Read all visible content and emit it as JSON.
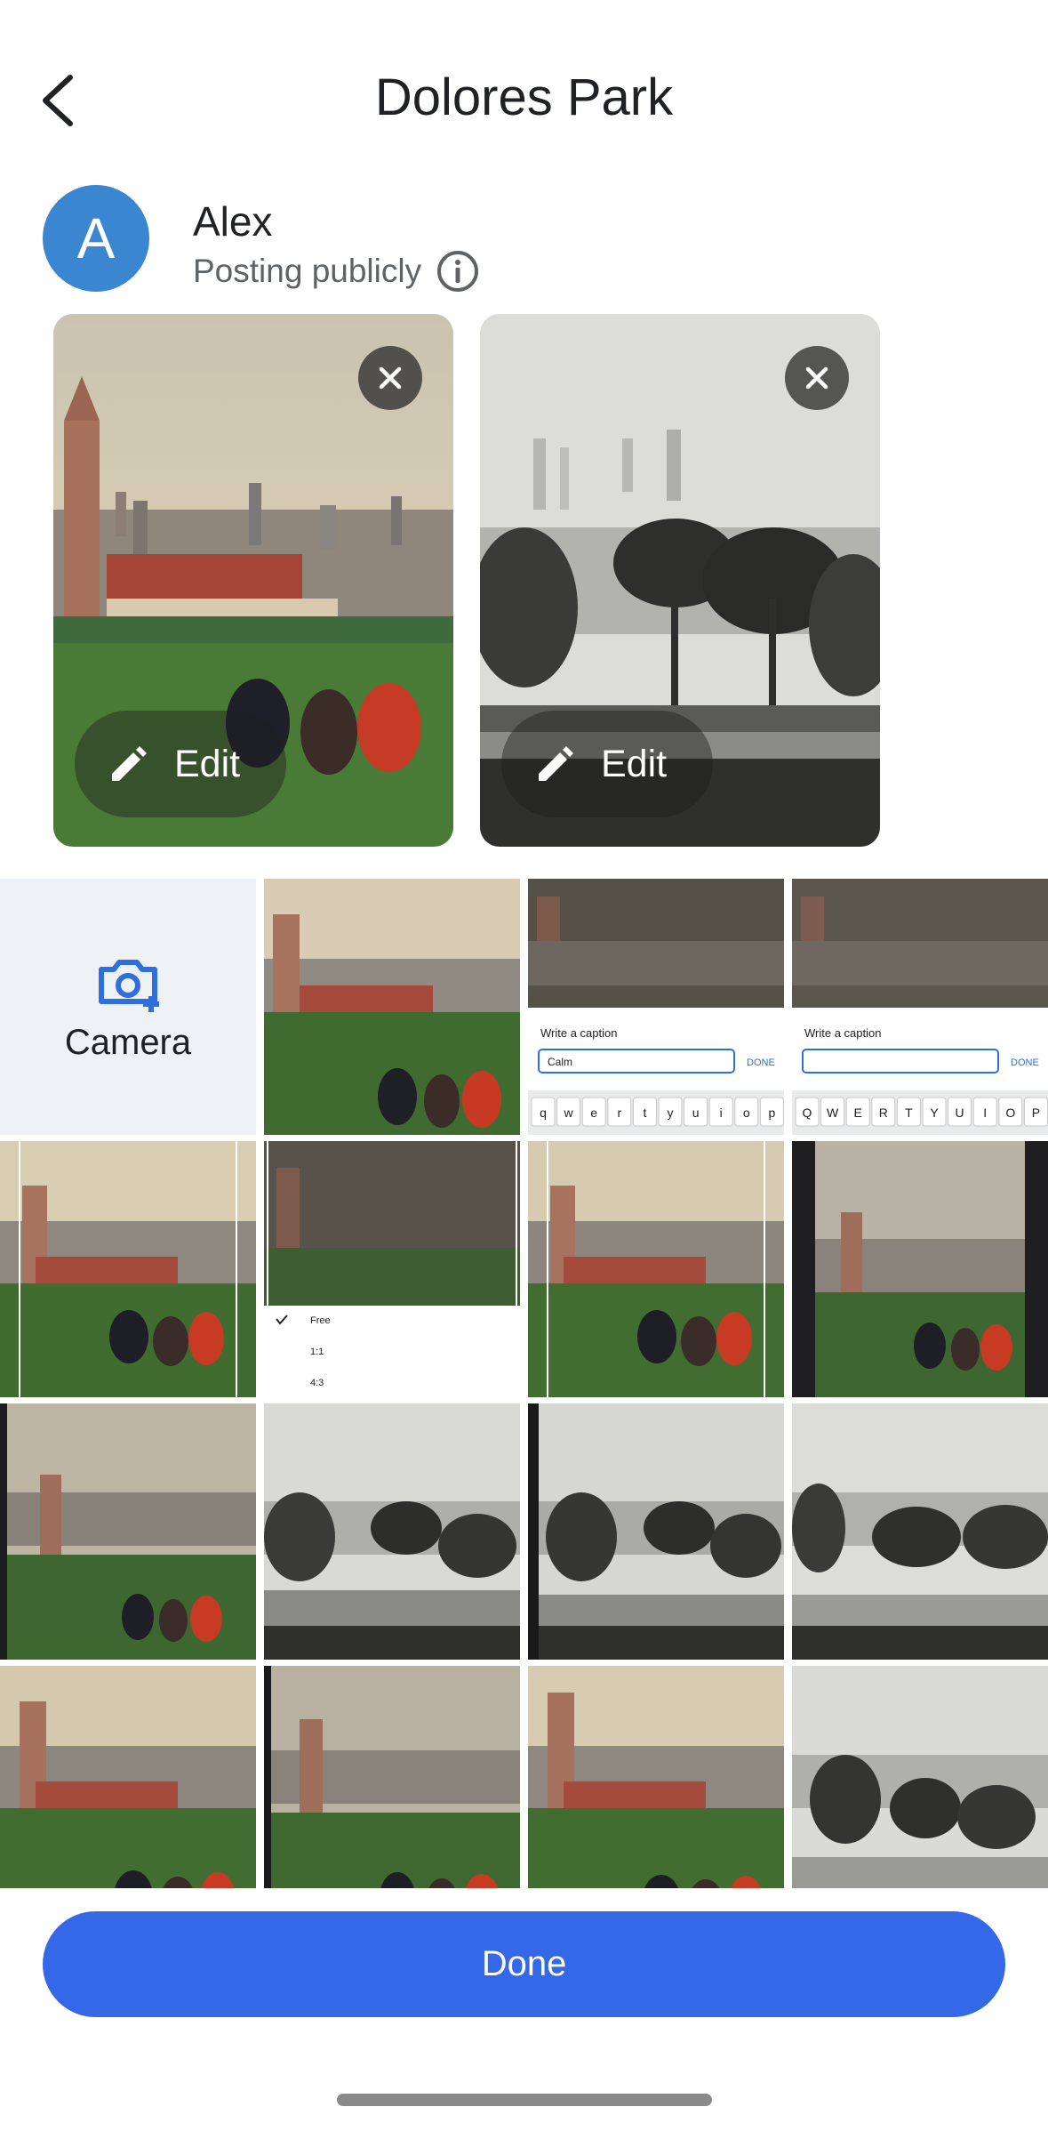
{
  "header": {
    "title": "Dolores Park",
    "back_icon": "chevron-left-icon"
  },
  "poster": {
    "avatar_letter": "A",
    "avatar_color": "#3a86d1",
    "name": "Alex",
    "visibility": "Posting publicly"
  },
  "selected": {
    "edit_label": "Edit",
    "photos": [
      {
        "style": "color"
      },
      {
        "style": "bw"
      }
    ]
  },
  "grid": {
    "camera_label": "Camera",
    "caption_screens": [
      {
        "title": "Write a caption",
        "input": "Calm",
        "done": "DONE",
        "keys": "qwertyuiop"
      },
      {
        "title": "Write a caption",
        "input": "",
        "done": "DONE",
        "keys": "QWERTYUIOP"
      }
    ],
    "crop_screen": {
      "options": [
        "Free",
        "1:1",
        "4:3"
      ]
    }
  },
  "footer": {
    "done_label": "Done",
    "accent": "#3468e6"
  }
}
